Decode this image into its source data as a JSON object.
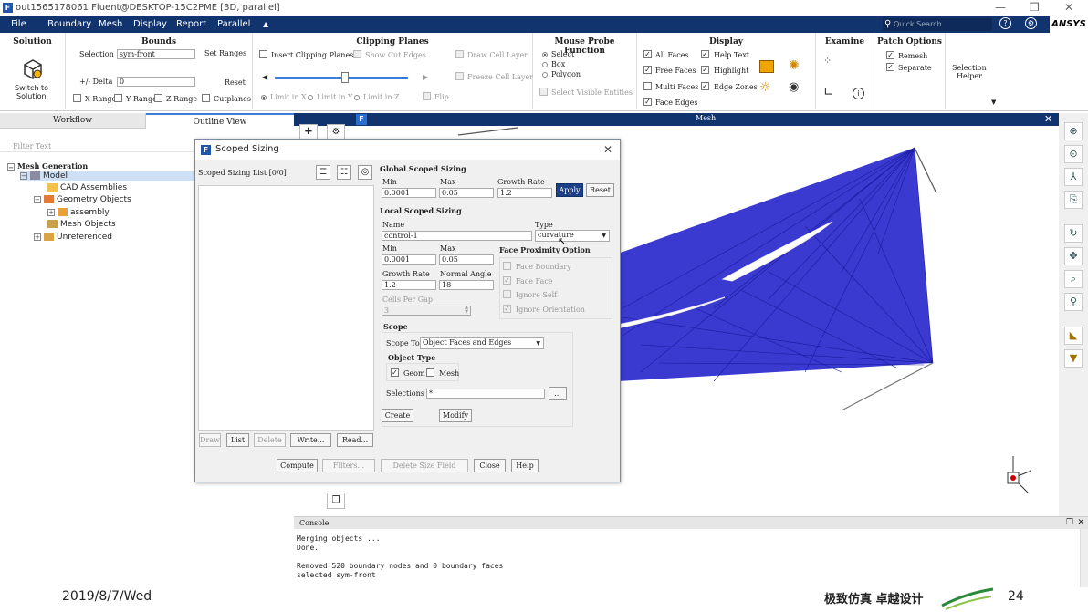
{
  "window": {
    "title": "out1565178061 Fluent@DESKTOP-15C2PME  [3D, parallel]",
    "app_icon": "F"
  },
  "menubar": {
    "items": [
      "File",
      "Boundary",
      "Mesh",
      "Display",
      "Report",
      "Parallel"
    ],
    "more_arrow": "▲",
    "search_placeholder": "Quick Search",
    "brand": "ANSYS"
  },
  "ribbon": {
    "solution": {
      "title": "Solution",
      "switch_label_1": "Switch to",
      "switch_label_2": "Solution"
    },
    "bounds": {
      "title": "Bounds",
      "selection_label": "Selection",
      "selection_value": "sym-front",
      "set_ranges": "Set Ranges",
      "delta_label": "+/- Delta",
      "delta_value": "0",
      "reset": "Reset",
      "x_range": "X Range",
      "y_range": "Y Range",
      "z_range": "Z Range"
    },
    "clipping": {
      "title": "Clipping Planes",
      "insert": "Insert Clipping Planes",
      "show_cut": "Show Cut Edges",
      "draw_cell": "Draw Cell Layer",
      "freeze_cell": "Freeze Cell Layer",
      "cutplanes": "Cutplanes",
      "flip": "Flip",
      "limit_x": "Limit in X",
      "limit_y": "Limit in Y",
      "limit_z": "Limit in Z"
    },
    "probe": {
      "title": "Mouse Probe Function",
      "select": "Select",
      "box": "Box",
      "polygon": "Polygon",
      "visible": "Select Visible Entities"
    },
    "display": {
      "title": "Display",
      "all_faces": "All Faces",
      "help_text": "Help Text",
      "free_faces": "Free Faces",
      "highlight": "Highlight",
      "multi_faces": "Multi Faces",
      "edge_zones": "Edge Zones",
      "face_edges": "Face Edges"
    },
    "examine": {
      "title": "Examine"
    },
    "patch": {
      "title": "Patch Options",
      "remesh": "Remesh",
      "separate": "Separate"
    },
    "selection_helper": {
      "line1": "Selection",
      "line2": "Helper"
    }
  },
  "tabs": {
    "workflow": "Workflow",
    "outline": "Outline View"
  },
  "filter_placeholder": "Filter Text",
  "tree": {
    "root": "Mesh Generation",
    "model": "Model",
    "cad": "CAD Assemblies",
    "geometry": "Geometry Objects",
    "assembly": "assembly",
    "mesh_objects": "Mesh Objects",
    "unreferenced": "Unreferenced"
  },
  "graphics": {
    "title": "Mesh",
    "panel_icon": "F"
  },
  "dialog": {
    "title": "Scoped Sizing",
    "list_label": "Scoped Sizing List [0/0]",
    "global_title": "Global Scoped Sizing",
    "min_label": "Min",
    "max_label": "Max",
    "growth_label": "Growth Rate",
    "global_min": "0.0001",
    "global_max": "0.05",
    "global_growth": "1.2",
    "apply": "Apply",
    "reset": "Reset",
    "local_title": "Local Scoped Sizing",
    "name_label": "Name",
    "name_value": "control-1",
    "type_label": "Type",
    "type_value": "curvature",
    "local_min": "0.0001",
    "local_max": "0.05",
    "proximity_title": "Face Proximity Option",
    "face_boundary": "Face Boundary",
    "face_face": "Face Face",
    "ignore_self": "Ignore Self",
    "ignore_orientation": "Ignore Orientation",
    "normal_angle_label": "Normal Angle",
    "local_growth": "1.2",
    "normal_angle": "18",
    "cells_per_gap_label": "Cells Per Gap",
    "cells_per_gap": "3",
    "scope_title": "Scope",
    "scope_to_label": "Scope To",
    "scope_to_value": "Object Faces and Edges",
    "object_type_title": "Object Type",
    "geom": "Geom",
    "mesh": "Mesh",
    "selections_label": "Selections",
    "selections_value": "*",
    "ellipsis": "...",
    "create": "Create",
    "modify": "Modify",
    "draw": "Draw",
    "list": "List",
    "delete": "Delete",
    "write": "Write...",
    "read": "Read...",
    "compute": "Compute",
    "filters": "Filters...",
    "delete_size_field": "Delete Size Field",
    "close": "Close",
    "help": "Help"
  },
  "console": {
    "title": "Console",
    "lines": [
      "Merging objects ...",
      "Done.",
      "",
      "Removed 520 boundary nodes and 0 boundary faces",
      "selected sym-front"
    ]
  },
  "footer": {
    "date": "2019/8/7/Wed",
    "slogan": "极致仿真 卓越设计",
    "page": "24"
  },
  "colors": {
    "menubar": "#12346e",
    "mesh_blue": "#3a3ad0",
    "mesh_dark": "#1a1aa0",
    "apply": "#1c3f85"
  }
}
